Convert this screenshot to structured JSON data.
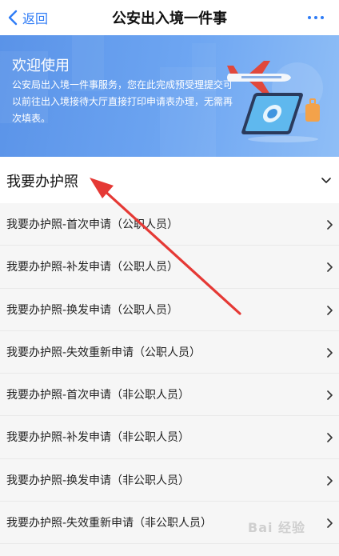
{
  "nav": {
    "back_label": "返回",
    "title": "公安出入境一件事"
  },
  "banner": {
    "title": "欢迎使用",
    "description": "公安局出入境一件事服务，您在此完成预受理提交可以前往出入境接待大厅直接打印申请表办理，无需再次填表。"
  },
  "section": {
    "title": "我要办护照"
  },
  "items": [
    {
      "label": "我要办护照-首次申请（公职人员）"
    },
    {
      "label": "我要办护照-补发申请（公职人员）"
    },
    {
      "label": "我要办护照-换发申请（公职人员）"
    },
    {
      "label": "我要办护照-失效重新申请（公职人员）"
    },
    {
      "label": "我要办护照-首次申请（非公职人员）"
    },
    {
      "label": "我要办护照-补发申请（非公职人员）"
    },
    {
      "label": "我要办护照-换发申请（非公职人员）"
    },
    {
      "label": "我要办护照-失效重新申请（非公职人员）"
    }
  ],
  "watermark": "Bai 经验",
  "colors": {
    "accent": "#2f7cf6",
    "banner_start": "#5a93e8",
    "banner_end": "#8fbef6",
    "annotation": "#e53935"
  },
  "icons": {
    "back": "chevron-left-icon",
    "more": "more-dots-icon",
    "section_toggle": "chevron-down-icon",
    "item": "chevron-right-icon"
  }
}
